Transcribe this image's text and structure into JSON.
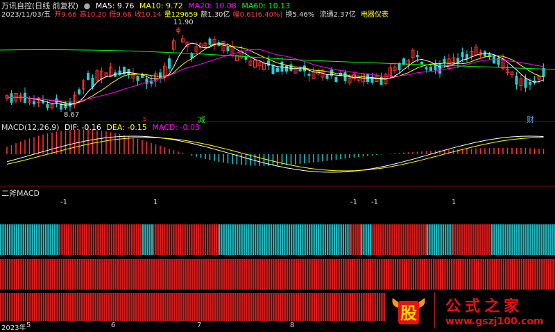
{
  "header": {
    "stock_name": "万讯自控(日线 前复权)",
    "ma5": "MA5: 9.76",
    "ma10": "MA10: 9.72",
    "ma20": "MA20: 10.08",
    "ma60": "MA60: 10.13",
    "date": "2023/11/03/五",
    "open": "开9.66",
    "high": "高10.20",
    "low": "低9.66",
    "close": "收10.14",
    "volume": "量129659",
    "amount": "额1.30亿",
    "change": "幅0.61(6.40%)",
    "turnover": "换5.46%",
    "float_cap": "流通2.37亿",
    "sector": "电器仪表"
  },
  "price_pane": {
    "high_mark": "11.90",
    "low_mark": "8.67",
    "markers": [
      {
        "text": "s",
        "color": "#e03030"
      },
      {
        "text": "减",
        "color": "#33dd33"
      },
      {
        "text": "财",
        "color": "#4fa3ff"
      }
    ]
  },
  "macd_pane": {
    "title": "MACD(12,26,9)",
    "dif": "DIF: -0.16",
    "dea": "DEA: -0.15",
    "macd": "MACD: -0.03"
  },
  "erfu_pane": {
    "title": "二斧MACD",
    "signals": [
      "-1",
      "1",
      "-1",
      "-1",
      "1"
    ]
  },
  "time_axis": {
    "year": "2023年",
    "months": [
      "5",
      "6",
      "7",
      "8"
    ]
  },
  "watermark": {
    "logo_char": "股",
    "slogan": "公式之家",
    "url": "www.gszj100.com"
  },
  "colors": {
    "up": "#ff3232",
    "down": "#21d1d1",
    "ma5": "#ffffff",
    "ma10": "#ffff00",
    "ma20": "#ff00ff",
    "ma60": "#00ff00",
    "bar_red": "#d41e1e",
    "bar_cyan": "#25b3bb"
  }
}
